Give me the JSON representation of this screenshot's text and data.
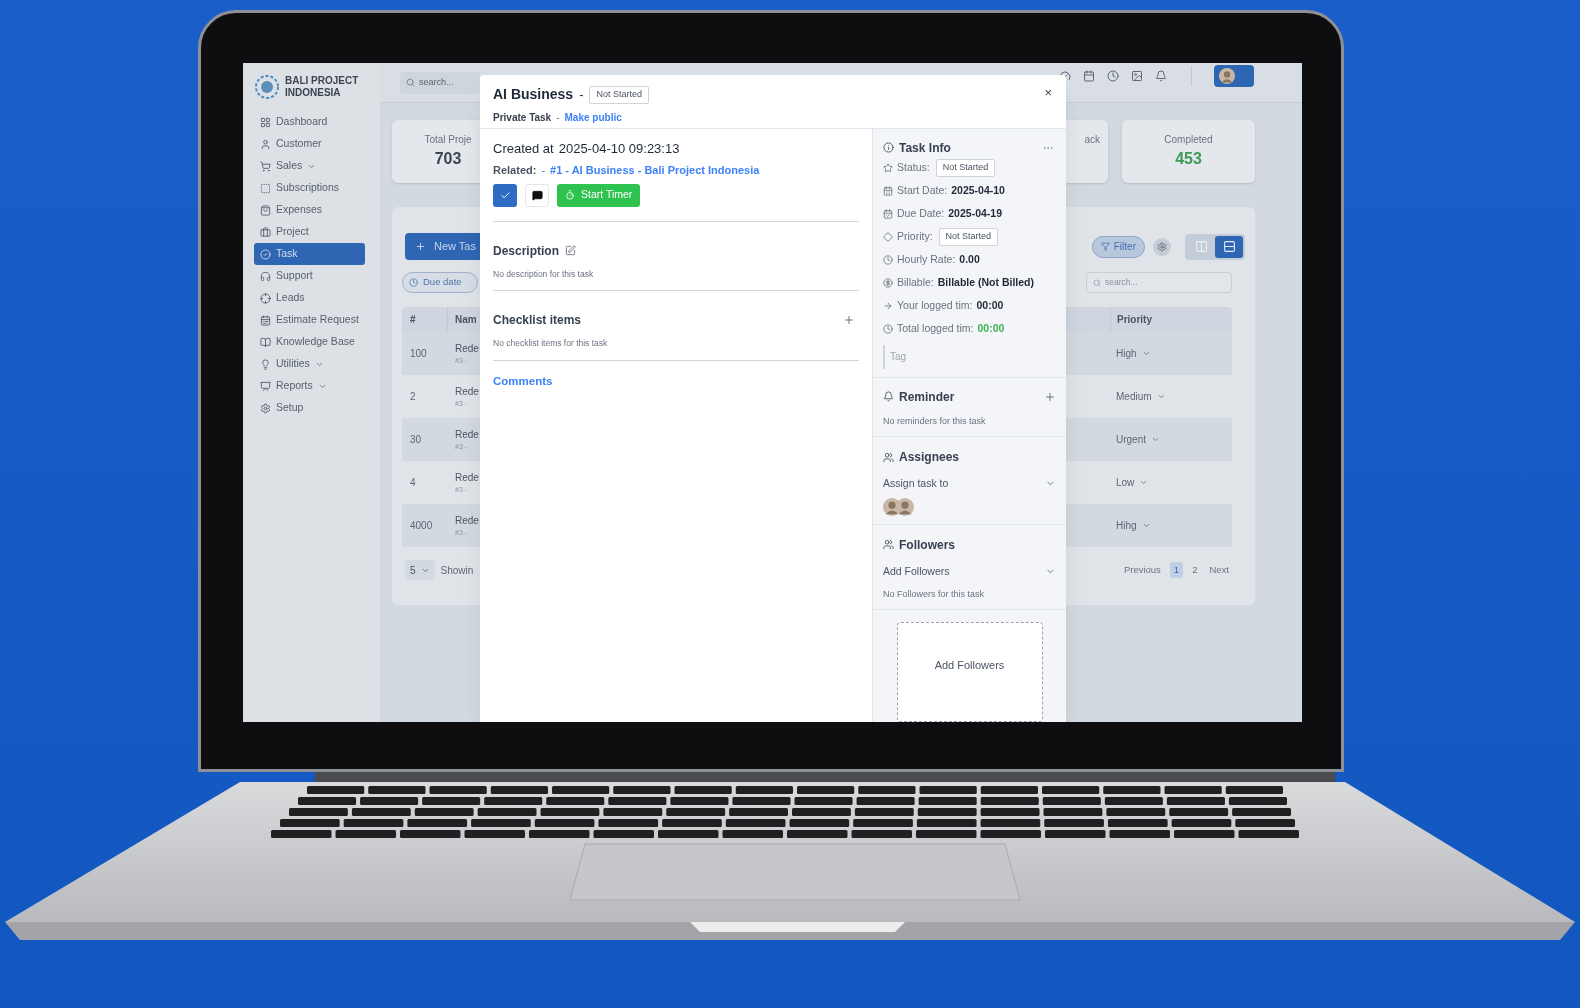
{
  "sidebar": {
    "brand_line_1": "BALI PROJECT",
    "brand_line_2": "INDONESIA",
    "items": [
      {
        "label": "Dashboard",
        "selected": false,
        "expandable": false
      },
      {
        "label": "Customer",
        "selected": false,
        "expandable": false
      },
      {
        "label": "Sales",
        "selected": false,
        "expandable": true
      },
      {
        "label": "Subscriptions",
        "selected": false,
        "expandable": false
      },
      {
        "label": "Expenses",
        "selected": false,
        "expandable": false
      },
      {
        "label": "Project",
        "selected": false,
        "expandable": false
      },
      {
        "label": "Task",
        "selected": true,
        "expandable": false
      },
      {
        "label": "Support",
        "selected": false,
        "expandable": false
      },
      {
        "label": "Leads",
        "selected": false,
        "expandable": false
      },
      {
        "label": "Estimate Request",
        "selected": false,
        "expandable": false
      },
      {
        "label": "Knowledge Base",
        "selected": false,
        "expandable": false
      },
      {
        "label": "Utilities",
        "selected": false,
        "expandable": true
      },
      {
        "label": "Reports",
        "selected": false,
        "expandable": true
      },
      {
        "label": "Setup",
        "selected": false,
        "expandable": false
      }
    ]
  },
  "topbar": {
    "search_placeholder": "search..."
  },
  "stat_cards": [
    {
      "label": "Total Proje",
      "value": "703"
    },
    {
      "label": "ack"
    },
    {
      "label": "Completed",
      "value": "453",
      "highlight": true
    }
  ],
  "tasks_panel": {
    "new_button": "New Tas",
    "due_date_chip": "Due date",
    "filter_button": "Filter",
    "view_modes": [
      {
        "kind": "board",
        "selected": false
      },
      {
        "kind": "list",
        "selected": true
      }
    ],
    "search_placeholder": "search...",
    "columns": [
      "#",
      "Nam",
      "Priority"
    ],
    "rows": [
      {
        "id": "100",
        "name": "Rede",
        "ref": "#3 -",
        "priority": "High"
      },
      {
        "id": "2",
        "name": "Rede",
        "ref": "#3 -",
        "priority": "Medium"
      },
      {
        "id": "30",
        "name": "Rede",
        "ref": "#3 -",
        "priority": "Urgent"
      },
      {
        "id": "4",
        "name": "Rede",
        "ref": "#3 -",
        "priority": "Low"
      },
      {
        "id": "4000",
        "name": "Rede",
        "ref": "#3 -",
        "priority": "Hihg"
      }
    ],
    "page_size": "5",
    "showing": "Showin",
    "pagination": [
      {
        "label": "Previous",
        "selected": false
      },
      {
        "label": "1",
        "selected": true
      },
      {
        "label": "2",
        "selected": false
      },
      {
        "label": "Next",
        "selected": false
      }
    ]
  },
  "modal": {
    "title": "AI Business",
    "title_separator": "-",
    "status": "Not Started",
    "visibility": "Private Task",
    "visibility_separator": "-",
    "visibility_action": "Make public",
    "close": "×",
    "created_label": "Created at",
    "created_value": "2025-04-10 09:23:13",
    "related_label": "Related:",
    "related_separator": "-",
    "related_link": "#1 - AI Business - Bali Project Indonesia",
    "timer_button": "Start Timer",
    "sections": [
      {
        "kind": "description",
        "title": "Description",
        "empty_text": "No description for this task"
      },
      {
        "kind": "checklist",
        "title": "Checklist items",
        "empty_text": "No checklist items for this task"
      }
    ],
    "comments_link": "Comments",
    "task_info": {
      "title": "Task Info",
      "fields": [
        {
          "label": "Status:",
          "value": "Not Started",
          "kind": "chip"
        },
        {
          "label": "Start Date:",
          "value": "2025-04-10",
          "kind": "plain"
        },
        {
          "label": "Due Date:",
          "value": "2025-04-19",
          "kind": "plain"
        },
        {
          "label": "Priority:",
          "value": "Not Started",
          "kind": "chip"
        },
        {
          "label": "Hourly Rate:",
          "value": "0.00",
          "kind": "plain"
        },
        {
          "label": "Billable:",
          "value": "Billable (Not Billed)",
          "kind": "plain"
        },
        {
          "label": "Your logged tim:",
          "value": "00:00",
          "kind": "plain"
        },
        {
          "label": "Total logged tim:",
          "value": "00:00",
          "kind": "success"
        }
      ],
      "tag_placeholder": "Tag"
    },
    "reminder": {
      "title": "Reminder",
      "empty_text": "No reminders for this task"
    },
    "assignees": {
      "title": "Assignees",
      "select_label": "Assign task to"
    },
    "followers": {
      "title": "Followers",
      "select_label": "Add Followers",
      "empty_text": "No Followers for this task",
      "drop_zone": "Add Followers"
    }
  }
}
